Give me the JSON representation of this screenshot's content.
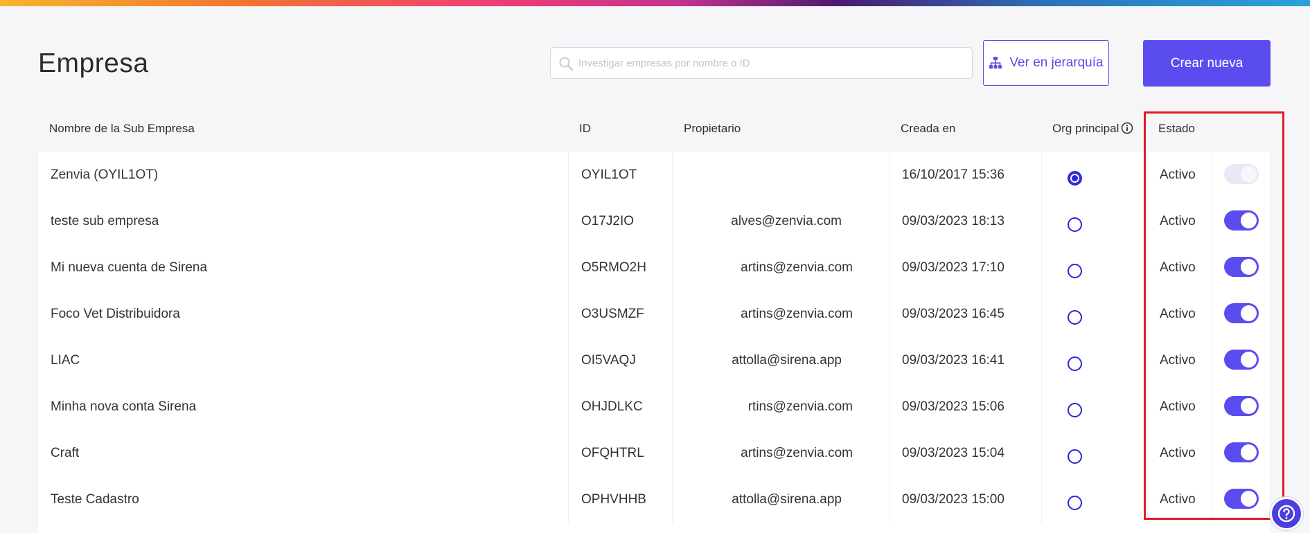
{
  "header": {
    "title": "Empresa",
    "search_placeholder": "Investigar empresas por nombre o ID",
    "search_value": "",
    "hierarchy_button_label": "Ver en jerarquía",
    "create_button_label": "Crear nueva"
  },
  "table": {
    "columns": {
      "name": "Nombre de la Sub Empresa",
      "id": "ID",
      "owner": "Propietario",
      "created": "Creada en",
      "org_principal": "Org principal",
      "status": "Estado"
    },
    "rows": [
      {
        "name": "Zenvia (OYIL1OT)",
        "id": "OYIL1OT",
        "owner": "",
        "created": "16/10/2017 15:36",
        "principal": true,
        "status": "Activo",
        "toggle_on": true,
        "toggle_disabled": true
      },
      {
        "name": "teste sub empresa",
        "id": "O17J2IO",
        "owner": "alves@zenvia.com",
        "created": "09/03/2023 18:13",
        "principal": false,
        "status": "Activo",
        "toggle_on": true,
        "toggle_disabled": false
      },
      {
        "name": "Mi nueva cuenta de Sirena",
        "id": "O5RMO2H",
        "owner": "artins@zenvia.com",
        "created": "09/03/2023 17:10",
        "principal": false,
        "status": "Activo",
        "toggle_on": true,
        "toggle_disabled": false
      },
      {
        "name": "Foco Vet Distribuidora",
        "id": "O3USMZF",
        "owner": "artins@zenvia.com",
        "created": "09/03/2023 16:45",
        "principal": false,
        "status": "Activo",
        "toggle_on": true,
        "toggle_disabled": false
      },
      {
        "name": "LIAC",
        "id": "OI5VAQJ",
        "owner": "attolla@sirena.app",
        "created": "09/03/2023 16:41",
        "principal": false,
        "status": "Activo",
        "toggle_on": true,
        "toggle_disabled": false
      },
      {
        "name": "Minha nova conta Sirena",
        "id": "OHJDLKC",
        "owner": "rtins@zenvia.com",
        "created": "09/03/2023 15:06",
        "principal": false,
        "status": "Activo",
        "toggle_on": true,
        "toggle_disabled": false
      },
      {
        "name": "Craft",
        "id": "OFQHTRL",
        "owner": "artins@zenvia.com",
        "created": "09/03/2023 15:04",
        "principal": false,
        "status": "Activo",
        "toggle_on": true,
        "toggle_disabled": false
      },
      {
        "name": "Teste Cadastro",
        "id": "OPHVHHB",
        "owner": "attolla@sirena.app",
        "created": "09/03/2023 15:00",
        "principal": false,
        "status": "Activo",
        "toggle_on": true,
        "toggle_disabled": false
      }
    ]
  },
  "colors": {
    "accent": "#5b4cf0",
    "radio": "#2a26d9",
    "highlight": "#e01b24"
  },
  "icons": {
    "search": "search-icon",
    "hierarchy": "hierarchy-icon",
    "info": "info-icon",
    "help": "help-icon"
  }
}
